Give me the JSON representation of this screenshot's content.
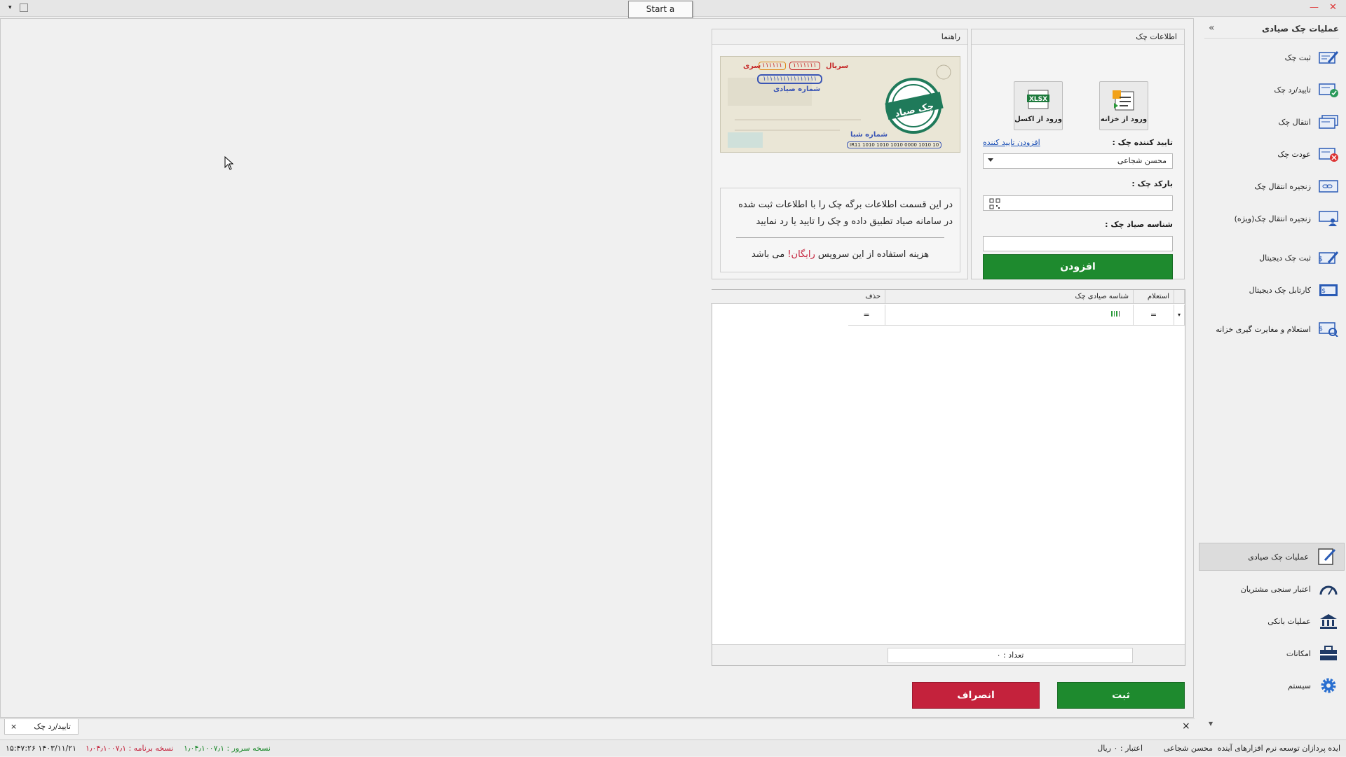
{
  "tooltip": "Start a capture.",
  "sidebar": {
    "header": "عملیات چک صیادی",
    "top_items": [
      {
        "label": "ثبت چک",
        "icon": "cheque-pen-icon"
      },
      {
        "label": "تایید/رد چک",
        "icon": "cheque-check-icon"
      },
      {
        "label": "انتقال چک",
        "icon": "cheque-transfer-icon"
      },
      {
        "label": "عودت چک",
        "icon": "cheque-return-icon"
      },
      {
        "label": "زنجیره انتقال چک",
        "icon": "cheque-chain-icon"
      },
      {
        "label": "زنجیره انتقال چک(ویژه)",
        "icon": "cheque-chain-user-icon"
      },
      {
        "label": "ثبت چک دیجیتال",
        "icon": "digital-cheque-pen-icon"
      },
      {
        "label": "کارتابل چک دیجیتال",
        "icon": "digital-cheque-cartable-icon"
      },
      {
        "label": "استعلام و مغایرت گیری خزانه",
        "icon": "treasury-inquiry-icon"
      }
    ],
    "bottom_items": [
      {
        "label": "عملیات چک صیادی",
        "icon": "edit-document-icon",
        "selected": true
      },
      {
        "label": "اعتبار سنجی مشتریان",
        "icon": "gauge-icon"
      },
      {
        "label": "عملیات بانکی",
        "icon": "bank-icon"
      },
      {
        "label": "امکانات",
        "icon": "toolbox-icon"
      },
      {
        "label": "سیستم",
        "icon": "gear-icon"
      }
    ]
  },
  "info_panel": {
    "title": "اطلاعات چک",
    "btn_treasury": "ورود از خزانه",
    "btn_excel": "ورود از اکسل",
    "excel_badge": "XLSX",
    "approver_label": "تایید کننده چک :",
    "add_approver_link": "افزودن تایید کننده",
    "approver_value": "محسن شجاعی",
    "barcode_label": "بارکد چک :",
    "barcode_value": "",
    "sayad_label": "شناسه صیاد چک :",
    "sayad_value": "",
    "add_button": "افزودن"
  },
  "guide_panel": {
    "title": "راهنما",
    "cheque_serial_label": "سریال",
    "cheque_series_label": "سری",
    "cheque_serial_value": "۱۱۱۱۱۱۱",
    "cheque_series_value": "۱۱۱۱۱۱",
    "cheque_sayad_number": "۱۱۱۱۱۱۱۱۱۱۱۱۱۱۱۱",
    "cheque_sayad_label": "شماره صیادی",
    "stamp_text": "چک صیاد",
    "sheba_label": "شماره شبا",
    "sheba_value": "IR11 1010 1010 1010 0000 1010 10",
    "help_text": "در این قسمت اطلاعات برگه چک را با اطلاعات ثبت شده در سامانه صیاد تطبیق داده و چک را تایید یا رد نمایید",
    "cost_prefix": "هزینه استفاده از این سرویس",
    "cost_free": "رایگان!",
    "cost_suffix": "می باشد"
  },
  "grid": {
    "col_inquiry": "استعلام",
    "col_sayad_id": "شناسه صیادی چک",
    "col_delete": "حذف",
    "row_inquiry": "=",
    "row_delete": "=",
    "count_text": "تعداد : ۰"
  },
  "actions": {
    "save": "ثبت",
    "cancel": "انصراف"
  },
  "tab": {
    "label": "تایید/رد چک",
    "close": "×"
  },
  "status": {
    "company": "ایده پردازان توسعه نرم افزارهای آینده",
    "user": "محسن شجاعی",
    "credit": "اعتبار : ۰ ریال",
    "server_version": "نسخه سرور : ۱٫۰۴٫۱۰۰۷٫۱",
    "app_version": "نسخه برنامه : ۱٫۰۴٫۱۰۰۷٫۱",
    "datetime": "۱۴۰۳/۱۱/۲۱ ۱۵:۴۷:۲۶"
  },
  "colors": {
    "green": "#1e8a2e",
    "red": "#c4223c",
    "link": "#1a4fb5"
  }
}
